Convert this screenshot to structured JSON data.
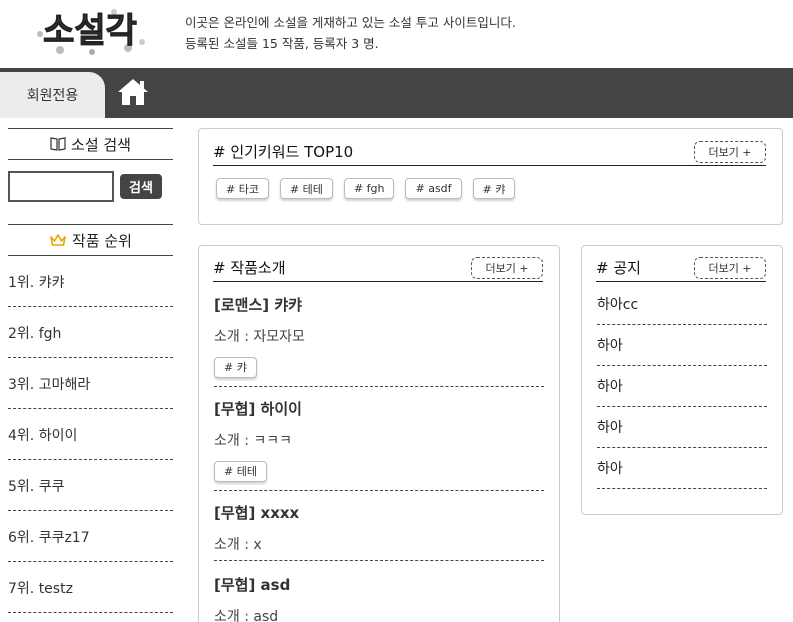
{
  "site": {
    "logo_text": "소설각",
    "intro_line1": "이곳은 온라인에 소설을 게재하고 있는 소설 투고 사이트입니다.",
    "intro_line2": "등록된 소설들 15 작품,  등록자 3 명."
  },
  "nav": {
    "member_label": "회원전용",
    "home_icon": "home-icon"
  },
  "sidebar": {
    "search_title": "소설 검색",
    "search_placeholder": "",
    "search_button": "검색",
    "rank_title": "작품 순위",
    "rank_items": [
      "1위. 캬캬",
      "2위. fgh",
      "3위. 고마해라",
      "4위. 하이이",
      "5위. 쿠쿠",
      "6위. 쿠쿠z17",
      "7위. testz"
    ]
  },
  "keywords": {
    "title": "# 인기키워드 TOP10",
    "more": "더보기 +",
    "tags": [
      "# 타코",
      "# 테테",
      "# fgh",
      "# asdf",
      "# 캬"
    ]
  },
  "works": {
    "title": "# 작품소개",
    "more": "더보기 +",
    "items": [
      {
        "title": "[로맨스] 캬캬",
        "desc": "소개 : 자모자모",
        "tag": "# 캬"
      },
      {
        "title": "[무협] 하이이",
        "desc": "소개 : ㅋㅋㅋ",
        "tag": "# 테테"
      },
      {
        "title": "[무협] xxxx",
        "desc": "소개 : x",
        "tag": ""
      },
      {
        "title": "[무협] asd",
        "desc": "소개 : asd",
        "tag": ""
      }
    ]
  },
  "notice": {
    "title": "# 공지",
    "more": "더보기 +",
    "items": [
      "하아cc",
      "하아",
      "하아",
      "하아",
      "하아"
    ]
  },
  "colors": {
    "nav_bg": "#444444",
    "member_tab_bg": "#ececec",
    "crown": "#e8a400"
  }
}
